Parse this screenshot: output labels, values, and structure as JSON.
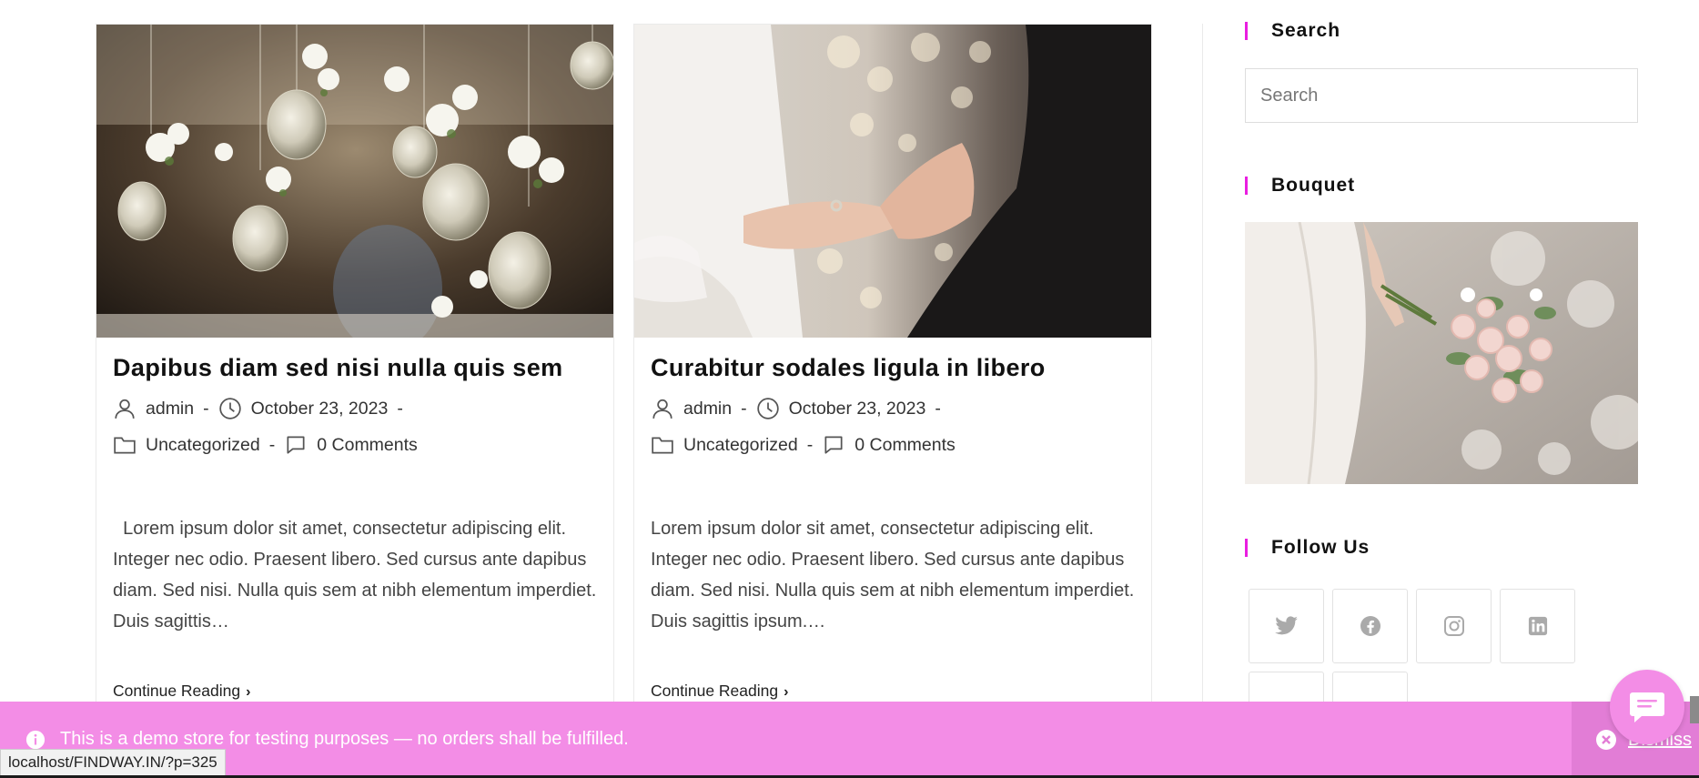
{
  "posts": [
    {
      "title": "Dapibus diam sed nisi nulla quis sem",
      "author": "admin",
      "date": "October 23, 2023",
      "category": "Uncategorized",
      "comments": "0 Comments",
      "excerpt": "  Lorem ipsum dolor sit amet, consectetur adipiscing elit. Integer nec odio. Praesent libero. Sed cursus ante dapibus diam. Sed nisi. Nulla quis sem at nibh elementum imperdiet. Duis sagittis…",
      "continue_label": "Continue Reading"
    },
    {
      "title": "Curabitur sodales ligula in libero",
      "author": "admin",
      "date": "October 23, 2023",
      "category": "Uncategorized",
      "comments": "0 Comments",
      "excerpt": "Lorem ipsum dolor sit amet, consectetur adipiscing elit. Integer nec odio. Praesent libero. Sed cursus ante dapibus diam. Sed nisi. Nulla quis sem at nibh elementum imperdiet. Duis sagittis ipsum.…",
      "continue_label": "Continue Reading"
    }
  ],
  "meta_separator": "-",
  "sidebar": {
    "search_title": "Search",
    "search_placeholder": "Search",
    "bouquet_title": "Bouquet",
    "follow_title": "Follow Us",
    "social_icons": [
      "twitter-icon",
      "facebook-icon",
      "instagram-icon",
      "linkedin-icon"
    ]
  },
  "notice": {
    "text": "This is a demo store for testing purposes — no orders shall be fulfilled.",
    "dismiss_label": "Dismiss"
  },
  "status_url": "localhost/FINDWAY.IN/?p=325",
  "colors": {
    "accent": "#e91ee0",
    "notice_bg": "#f38de6"
  }
}
